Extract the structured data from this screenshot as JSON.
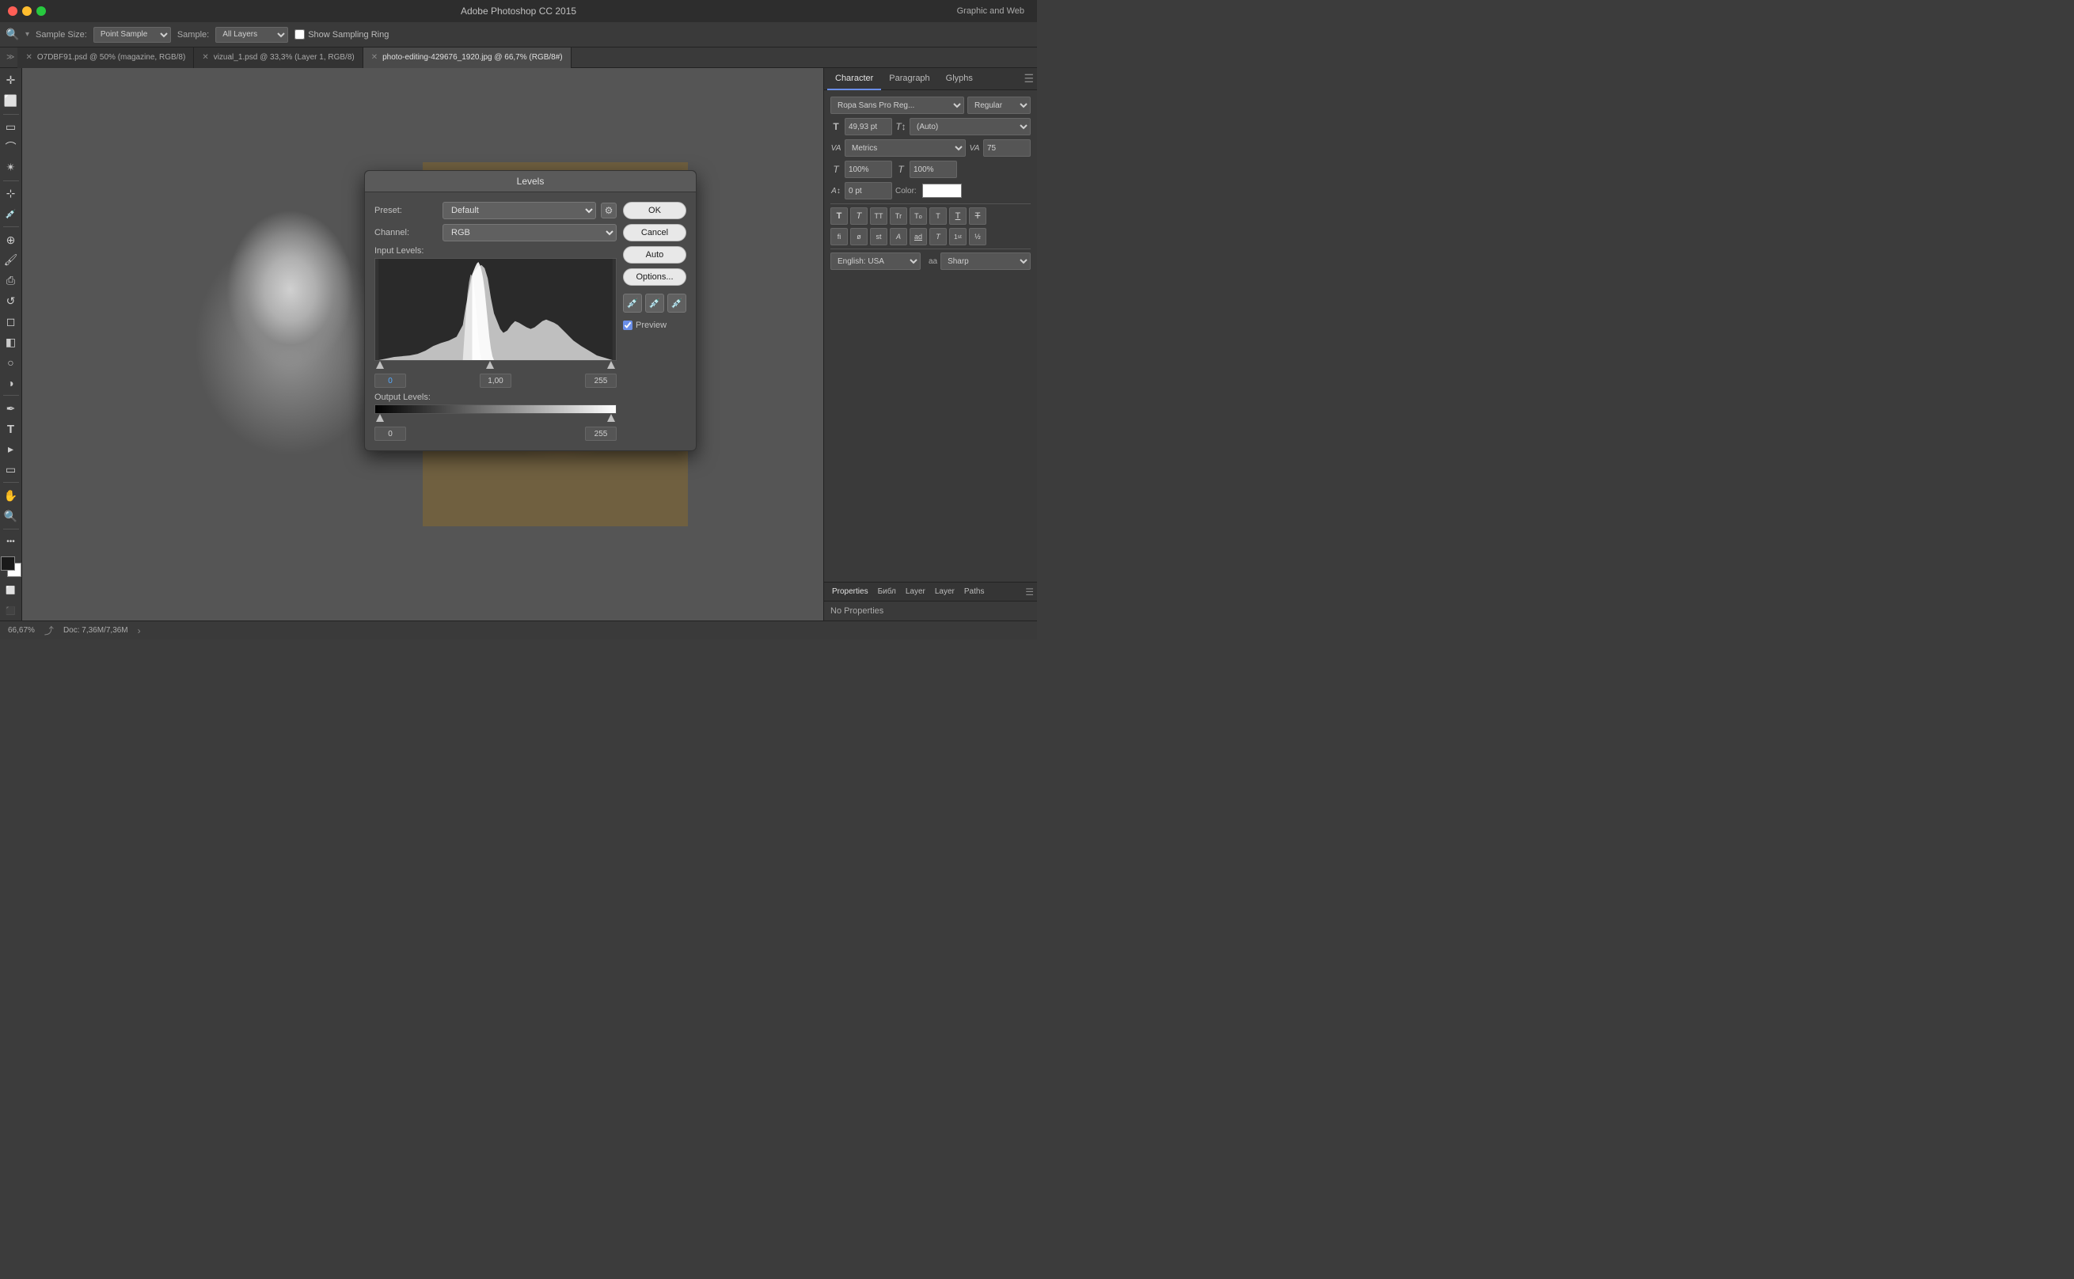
{
  "titlebar": {
    "title": "Adobe Photoshop CC 2015",
    "right": "Graphic and Web"
  },
  "toolbar": {
    "sample_size_label": "Sample Size:",
    "sample_size_value": "Point Sample",
    "sample_label": "Sample:",
    "sample_value": "All Layers",
    "sampling_ring_label": "Show Sampling Ring"
  },
  "tabs": [
    {
      "label": "O7DBF91.psd @ 50% (magazine, RGB/8)",
      "active": false
    },
    {
      "label": "vizual_1.psd @ 33,3% (Layer 1, RGB/8)",
      "active": false
    },
    {
      "label": "photo-editing-429676_1920.jpg @ 66,7% (RGB/8#)",
      "active": true
    }
  ],
  "character_panel": {
    "tabs": [
      "Character",
      "Paragraph",
      "Glyphs"
    ],
    "active_tab": "Character",
    "font_family": "Ropa Sans Pro Reg...",
    "font_style": "Regular",
    "font_size": "49,93 pt",
    "leading": "(Auto)",
    "kerning": "Metrics",
    "tracking": "75",
    "scale_h": "100%",
    "scale_v": "100%",
    "baseline_shift": "0 pt",
    "color_label": "Color:",
    "type_styles": [
      "T",
      "T",
      "TT",
      "Tr",
      "T°",
      "T",
      "T↓",
      "T",
      "T̲"
    ],
    "opentype_styles": [
      "fi",
      "ø",
      "st",
      "A",
      "ad",
      "T",
      "1st",
      "½"
    ],
    "language": "English: USA",
    "aa_label": "aa",
    "aa_value": "Sharp"
  },
  "properties_panel": {
    "tabs": [
      "Properties",
      "Библ",
      "Layer",
      "Layer",
      "Paths"
    ],
    "active_tab": "Properties",
    "content": "No Properties"
  },
  "levels_dialog": {
    "title": "Levels",
    "preset_label": "Preset:",
    "preset_value": "Default",
    "channel_label": "Channel:",
    "channel_value": "RGB",
    "input_levels_label": "Input Levels:",
    "input_values": [
      "0",
      "1,00",
      "255"
    ],
    "output_levels_label": "Output Levels:",
    "output_values": [
      "0",
      "255"
    ],
    "buttons": [
      "OK",
      "Cancel",
      "Auto",
      "Options..."
    ],
    "preview_label": "Preview",
    "preview_checked": true
  },
  "statusbar": {
    "zoom": "66,67%",
    "doc_info": "Doc: 7,36M/7,36M"
  }
}
